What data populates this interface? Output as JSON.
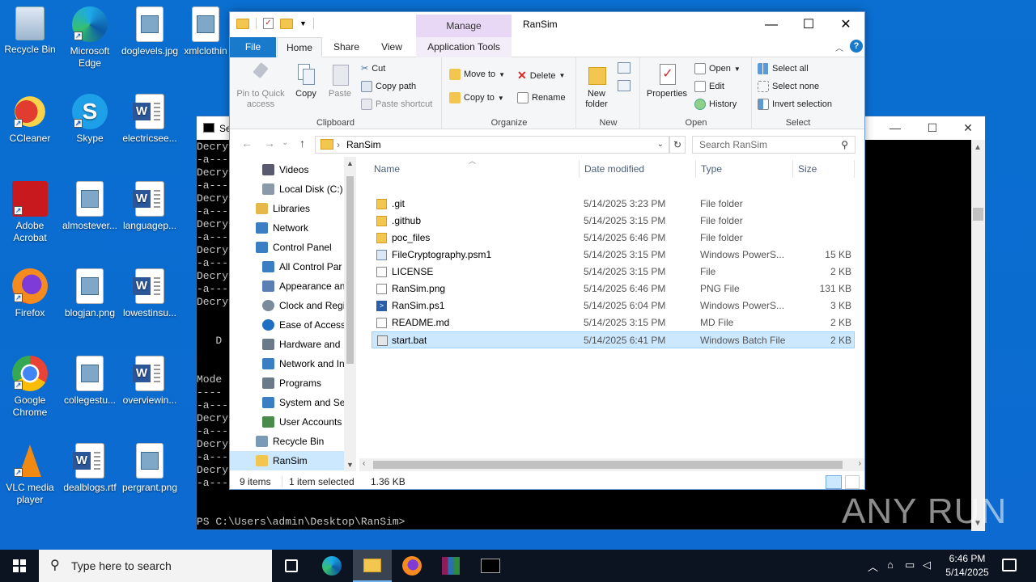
{
  "desktop": {
    "icons": [
      {
        "label": "Recycle Bin"
      },
      {
        "label": "Microsoft Edge"
      },
      {
        "label": "doglevels.jpg"
      },
      {
        "label": "xmlclothin"
      },
      {
        "label": "CCleaner"
      },
      {
        "label": "Skype"
      },
      {
        "label": "electricsee..."
      },
      {
        "label": "Adobe Acrobat"
      },
      {
        "label": "almostever..."
      },
      {
        "label": "languagep..."
      },
      {
        "label": "Firefox"
      },
      {
        "label": "blogjan.png"
      },
      {
        "label": "lowestinsu..."
      },
      {
        "label": "Google Chrome"
      },
      {
        "label": "collegestu..."
      },
      {
        "label": "overviewin..."
      },
      {
        "label": "VLC media player"
      },
      {
        "label": "dealblogs.rtf"
      },
      {
        "label": "pergrant.png"
      }
    ]
  },
  "console": {
    "title": "Se",
    "lines": "Decry\n-a---\nDecry\n-a---\nDecry\n-a---\nDecry\n-a---\nDecry\n-a---\nDecry\n-a---\nDecry\n\n\n   D\n\n\nMode\n----\n-a---\nDecry\n-a---\nDecry\n-a---\nDecry\n-a---",
    "prompt": "PS C:\\Users\\admin\\Desktop\\RanSim>"
  },
  "explorer": {
    "title": "RanSim",
    "manage_label": "Manage",
    "tabs": {
      "file": "File",
      "home": "Home",
      "share": "Share",
      "view": "View",
      "app_tools": "Application Tools"
    },
    "ribbon": {
      "clipboard": {
        "label": "Clipboard",
        "pin": "Pin to Quick access",
        "copy": "Copy",
        "paste": "Paste",
        "cut": "Cut",
        "copy_path": "Copy path",
        "paste_shortcut": "Paste shortcut"
      },
      "organize": {
        "label": "Organize",
        "move_to": "Move to",
        "copy_to": "Copy to",
        "delete": "Delete",
        "rename": "Rename"
      },
      "new": {
        "label": "New",
        "new_folder": "New folder"
      },
      "open": {
        "label": "Open",
        "properties": "Properties",
        "open": "Open",
        "edit": "Edit",
        "history": "History"
      },
      "select": {
        "label": "Select",
        "select_all": "Select all",
        "select_none": "Select none",
        "invert": "Invert selection"
      }
    },
    "address": {
      "path": "RanSim",
      "search_placeholder": "Search RanSim"
    },
    "nav": [
      {
        "label": "Videos",
        "color": "#5a5a6e"
      },
      {
        "label": "Local Disk (C:)",
        "color": "#8a9aa8"
      },
      {
        "label": "Libraries",
        "color": "#e6b84a"
      },
      {
        "label": "Network",
        "color": "#3a7fc4"
      },
      {
        "label": "Control Panel",
        "color": "#3a7fc4"
      },
      {
        "label": "All Control Par",
        "color": "#3a7fc4"
      },
      {
        "label": "Appearance an",
        "color": "#5a7fb4"
      },
      {
        "label": "Clock and Regi",
        "color": "#7a8a98"
      },
      {
        "label": "Ease of Access",
        "color": "#1e6fc4"
      },
      {
        "label": "Hardware and",
        "color": "#6a7a88"
      },
      {
        "label": "Network and In",
        "color": "#3a7fc4"
      },
      {
        "label": "Programs",
        "color": "#6a7a88"
      },
      {
        "label": "System and Sec",
        "color": "#3a7fc4"
      },
      {
        "label": "User Accounts",
        "color": "#4a8a4a"
      },
      {
        "label": "Recycle Bin",
        "color": "#7a9ab8"
      },
      {
        "label": "RanSim",
        "color": "#f3c74f"
      }
    ],
    "columns": {
      "name": "Name",
      "date": "Date modified",
      "type": "Type",
      "size": "Size"
    },
    "files": [
      {
        "name": ".git",
        "date": "5/14/2025 3:23 PM",
        "type": "File folder",
        "size": "",
        "kind": "folder"
      },
      {
        "name": ".github",
        "date": "5/14/2025 3:15 PM",
        "type": "File folder",
        "size": "",
        "kind": "folder"
      },
      {
        "name": "poc_files",
        "date": "5/14/2025 6:46 PM",
        "type": "File folder",
        "size": "",
        "kind": "folder"
      },
      {
        "name": "FileCryptography.psm1",
        "date": "5/14/2025 3:15 PM",
        "type": "Windows PowerS...",
        "size": "15 KB",
        "kind": "psm"
      },
      {
        "name": "LICENSE",
        "date": "5/14/2025 3:15 PM",
        "type": "File",
        "size": "2 KB",
        "kind": "file"
      },
      {
        "name": "RanSim.png",
        "date": "5/14/2025 6:46 PM",
        "type": "PNG File",
        "size": "131 KB",
        "kind": "png"
      },
      {
        "name": "RanSim.ps1",
        "date": "5/14/2025 6:04 PM",
        "type": "Windows PowerS...",
        "size": "3 KB",
        "kind": "ps1"
      },
      {
        "name": "README.md",
        "date": "5/14/2025 3:15 PM",
        "type": "MD File",
        "size": "2 KB",
        "kind": "file"
      },
      {
        "name": "start.bat",
        "date": "5/14/2025 6:41 PM",
        "type": "Windows Batch File",
        "size": "2 KB",
        "kind": "bat"
      }
    ],
    "status": {
      "count": "9 items",
      "selected": "1 item selected",
      "size": "1.36 KB"
    }
  },
  "taskbar": {
    "search_placeholder": "Type here to search",
    "time": "6:46 PM",
    "date": "5/14/2025"
  },
  "watermark": "ANY RUN"
}
